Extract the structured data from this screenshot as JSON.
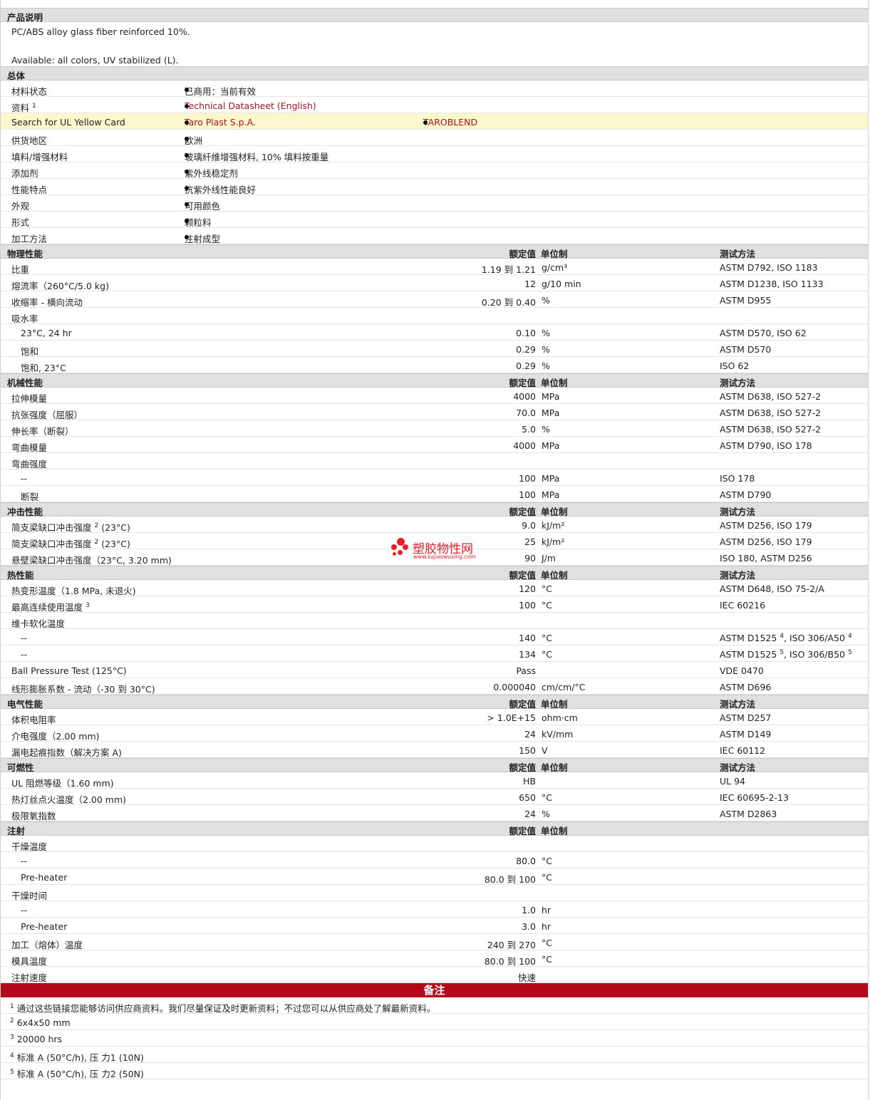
{
  "desc": {
    "title": "产品说明",
    "line1": "PC/ABS alloy glass fiber reinforced 10%.",
    "line2": "Available: all colors, UV stabilized (L)."
  },
  "general": {
    "title": "总体",
    "rows": [
      {
        "label": "材料状态",
        "value": "已商用：当前有效"
      },
      {
        "label": "资料",
        "sup": "1",
        "value": "Technical Datasheet (English)"
      },
      {
        "label": "Search for UL Yellow Card",
        "value": "Taro Plast S.p.A.",
        "value2": "TAROBLEND"
      },
      {
        "label": "供货地区",
        "value": "欧洲"
      },
      {
        "label": "填料/增强材料",
        "value": "玻璃纤维增强材料, 10% 填料按重量"
      },
      {
        "label": "添加剂",
        "value": "紫外线稳定剂"
      },
      {
        "label": "性能特点",
        "value": "抗紫外线性能良好"
      },
      {
        "label": "外观",
        "value": "可用颜色"
      },
      {
        "label": "形式",
        "value": "颗粒料"
      },
      {
        "label": "加工方法",
        "value": "注射成型"
      }
    ]
  },
  "hdr": {
    "value": "额定值",
    "unit": "单位制",
    "method": "测试方法"
  },
  "physical": {
    "title": "物理性能",
    "rows": [
      {
        "label": "比重",
        "value": "1.19 到  1.21",
        "unit": "g/cm³",
        "method": "ASTM D792, ISO 1183"
      },
      {
        "label": "熔流率（260°C/5.0 kg)",
        "value": "12",
        "unit": "g/10 min",
        "method": "ASTM D1238, ISO 1133"
      },
      {
        "label": "收缩率  - 横向流动",
        "value": "0.20 到  0.40",
        "unit": "%",
        "method": "ASTM D955"
      },
      {
        "label": "吸水率"
      },
      {
        "label": "23°C, 24 hr",
        "value": "0.10",
        "unit": "%",
        "method": "ASTM D570, ISO 62",
        "ind": true
      },
      {
        "label": "饱和",
        "value": "0.29",
        "unit": "%",
        "method": "ASTM D570",
        "ind": true
      },
      {
        "label": "饱和, 23°C",
        "value": "0.29",
        "unit": "%",
        "method": "ISO 62",
        "ind": true
      }
    ]
  },
  "mechanical": {
    "title": "机械性能",
    "rows": [
      {
        "label": "拉伸模量",
        "value": "4000",
        "unit": "MPa",
        "method": "ASTM D638, ISO 527-2"
      },
      {
        "label": "抗张强度（屈服）",
        "value": "70.0",
        "unit": "MPa",
        "method": "ASTM D638, ISO 527-2"
      },
      {
        "label": "伸长率（断裂）",
        "value": "5.0",
        "unit": "%",
        "method": "ASTM D638, ISO 527-2"
      },
      {
        "label": "弯曲模量",
        "value": "4000",
        "unit": "MPa",
        "method": "ASTM D790, ISO 178"
      },
      {
        "label": "弯曲强度"
      },
      {
        "label": "--",
        "value": "100",
        "unit": "MPa",
        "method": "ISO 178",
        "ind": true
      },
      {
        "label": "断裂",
        "value": "100",
        "unit": "MPa",
        "method": "ASTM D790",
        "ind": true
      }
    ]
  },
  "impact": {
    "title": "冲击性能",
    "rows": [
      {
        "label": "简支梁缺口冲击强度",
        "sup": "2",
        "label2": " (23°C)",
        "value": "9.0",
        "unit": "kJ/m²",
        "method": "ASTM D256, ISO 179"
      },
      {
        "label": "简支梁缺口冲击强度",
        "sup": "2",
        "label2": " (23°C)",
        "value": "25",
        "unit": "kJ/m²",
        "method": "ASTM D256, ISO 179"
      },
      {
        "label": "悬壁梁缺口冲击强度（23°C, 3.20 mm)",
        "value": "90",
        "unit": "J/m",
        "method": "ISO 180, ASTM D256"
      }
    ]
  },
  "thermal": {
    "title": "热性能",
    "rows": [
      {
        "label": "热变形温度（1.8 MPa, 未退火)",
        "value": "120",
        "unit": "°C",
        "method": "ASTM D648, ISO 75-2/A"
      },
      {
        "label": "最高连续使用温度",
        "sup": "3",
        "value": "100",
        "unit": "°C",
        "method": "IEC 60216"
      },
      {
        "label": "维卡软化温度"
      },
      {
        "label": "--",
        "value": "140",
        "unit": "°C",
        "method": "ASTM D1525",
        "msup": "4",
        "method2": ", ISO 306/A50",
        "msup2": "4",
        "ind": true
      },
      {
        "label": "--",
        "value": "134",
        "unit": "°C",
        "method": "ASTM D1525",
        "msup": "5",
        "method2": ", ISO 306/B50",
        "msup2": "5",
        "ind": true
      },
      {
        "label": "Ball Pressure Test (125°C)",
        "value": "Pass",
        "method": "VDE 0470"
      },
      {
        "label": "线形膨胀系数  - 流动（-30 到  30°C)",
        "value": "0.000040",
        "unit": "cm/cm/°C",
        "method": "ASTM D696"
      }
    ]
  },
  "electrical": {
    "title": "电气性能",
    "rows": [
      {
        "label": "体积电阻率",
        "value": "> 1.0E+15",
        "unit": "ohm·cm",
        "method": "ASTM D257"
      },
      {
        "label": "介电强度（2.00 mm)",
        "value": "24",
        "unit": "kV/mm",
        "method": "ASTM D149"
      },
      {
        "label": "漏电起痕指数（解决方案  A)",
        "value": "150",
        "unit": "V",
        "method": "IEC 60112"
      }
    ]
  },
  "flammability": {
    "title": "可燃性",
    "rows": [
      {
        "label": "UL 阻燃等级（1.60 mm)",
        "value": "HB",
        "method": "UL 94"
      },
      {
        "label": "热灯丝点火温度（2.00 mm)",
        "value": "650",
        "unit": "°C",
        "method": "IEC 60695-2-13"
      },
      {
        "label": "极限氧指数",
        "value": "24",
        "unit": "%",
        "method": "ASTM D2863"
      }
    ]
  },
  "injection": {
    "title": "注射",
    "rows": [
      {
        "label": "干燥温度"
      },
      {
        "label": "--",
        "value": "80.0",
        "unit": "°C",
        "ind": true
      },
      {
        "label": "Pre-heater",
        "value": "80.0 到  100",
        "unit": "°C",
        "ind": true
      },
      {
        "label": "干燥时间"
      },
      {
        "label": "--",
        "value": "1.0",
        "unit": "hr",
        "ind": true
      },
      {
        "label": "Pre-heater",
        "value": "3.0",
        "unit": "hr",
        "ind": true
      },
      {
        "label": "加工（熔体）温度",
        "value": "240 到  270",
        "unit": "°C"
      },
      {
        "label": "模具温度",
        "value": "80.0 到  100",
        "unit": "°C"
      },
      {
        "label": "注射速度",
        "value": "快速"
      }
    ]
  },
  "notes": {
    "title": "备注",
    "items": [
      {
        "num": "1",
        "text": "通过这些链接您能够访问供应商资料。我们尽量保证及时更新资料；不过您可以从供应商处了解最新资料。"
      },
      {
        "num": "2",
        "text": "6x4x50 mm"
      },
      {
        "num": "3",
        "text": "20000 hrs"
      },
      {
        "num": "4",
        "text": "标准  A (50°C/h), 压  力1 (10N)"
      },
      {
        "num": "5",
        "text": "标准  A (50°C/h), 压  力2 (50N)"
      }
    ]
  },
  "watermark": {
    "name": "塑胶物性网",
    "url": "www.sujiaowuxing.com"
  },
  "colors": {
    "link": "#a8141e",
    "notes_bar": "#b5061e",
    "section_bg": "#e0e0e0",
    "highlight": "#fcf7cc",
    "watermark": "#e8202c"
  }
}
